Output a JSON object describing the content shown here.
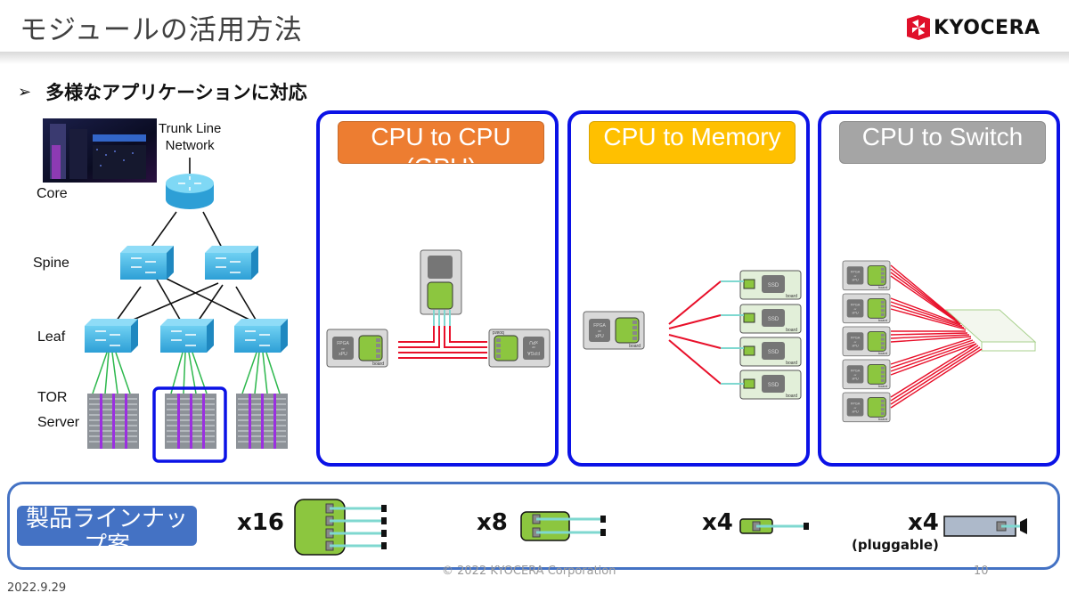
{
  "header": {
    "title": "モジュールの活用方法",
    "logo_text": "KYOCERA"
  },
  "bullet": {
    "text": "多様なアプリケーションに対応"
  },
  "network": {
    "trunk_label_line1": "Trunk Line",
    "trunk_label_line2": "Network",
    "levels": [
      "Core",
      "Spine",
      "Leaf",
      "TOR",
      "Server"
    ]
  },
  "panels": [
    {
      "title": "CPU to CPU (GPU)",
      "color": "#ed7d31",
      "chip_label": "FPGA or xPU",
      "board_label": "board"
    },
    {
      "title": "CPU to Memory",
      "color": "#ffc000",
      "chip_label": "FPGA or xPU",
      "board_label": "board",
      "device_label": "SSD"
    },
    {
      "title": "CPU to Switch",
      "color": "#a5a5a5",
      "chip_label": "FPGA or xPU",
      "board_label": "board"
    }
  ],
  "lineup": {
    "title": "製品ラインナップ案",
    "items": [
      {
        "multiplier": "x16"
      },
      {
        "multiplier": "x8"
      },
      {
        "multiplier": "x4"
      },
      {
        "multiplier": "x4",
        "note": "(pluggable)"
      }
    ]
  },
  "footer": {
    "date": "2022.9.29",
    "copyright": "© 2022 KYOCERA Corporation",
    "page": "10"
  },
  "colors": {
    "panel_border": "#0b12e6",
    "lineup_border": "#4472c4",
    "module_green": "#8cc63f",
    "cable_red": "#e8102a",
    "fiber_cyan": "#7fd8d0"
  }
}
